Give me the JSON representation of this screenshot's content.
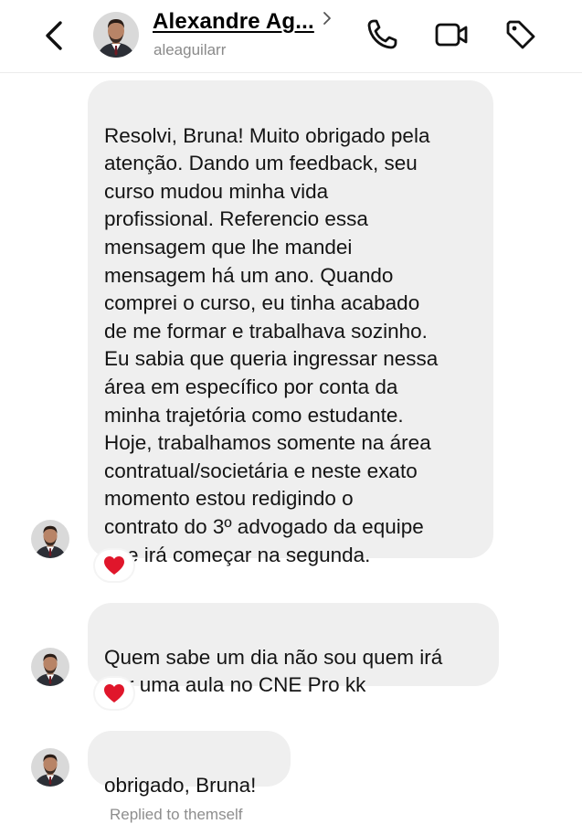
{
  "header": {
    "name": "Alexandre Ag...",
    "handle": "aleaguilarr"
  },
  "messages": [
    {
      "text": "Resolvi, Bruna! Muito obrigado pela\natenção. Dando um feedback, seu\ncurso mudou minha vida\nprofissional. Referencio essa\nmensagem que lhe mandei\nmensagem há um ano. Quando\ncomprei o curso, eu tinha acabado\nde me formar e trabalhava sozinho.\nEu sabia que queria ingressar nessa\nárea em específico por conta da\nminha trajetória como estudante.\nHoje, trabalhamos somente na área\ncontratual/societária e neste exato\nmomento estou redigindo o\ncontrato do 3º advogado da equipe\nque irá começar na segunda.",
      "reaction": "heart"
    },
    {
      "text": "Quem sabe um dia não sou quem irá\ndar uma aula no CNE Pro kk",
      "reaction": "heart"
    },
    {
      "text": "obrigado, Bruna!"
    }
  ],
  "footer": {
    "note": "Replied to themself"
  },
  "colors": {
    "bubble": "#efefef",
    "heart": "#e0162b"
  }
}
